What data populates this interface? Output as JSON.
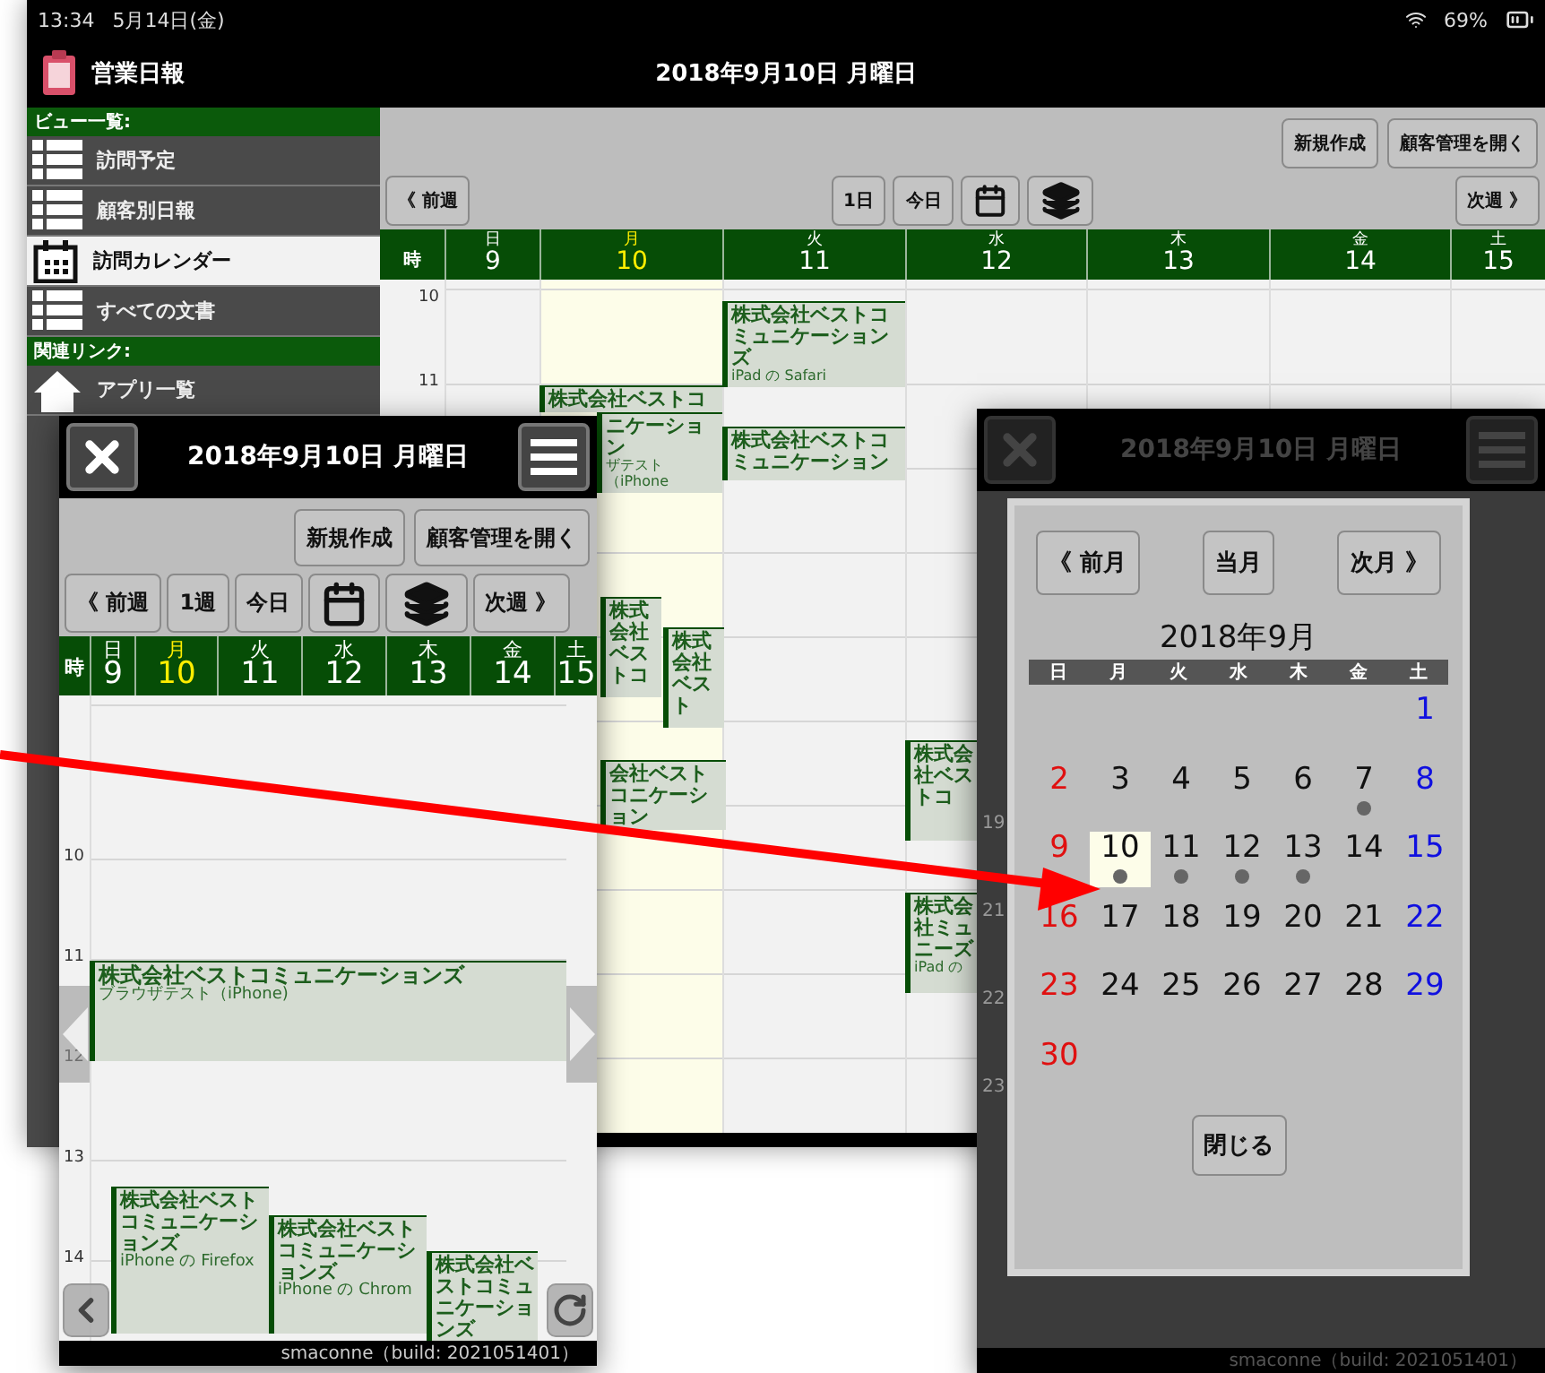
{
  "status_bar": {
    "time": "13:34",
    "date": "5月14日(金)",
    "battery": "69%"
  },
  "app": {
    "title": "営業日報",
    "date_title": "2018年9月10日 月曜日"
  },
  "sidebar": {
    "sections": [
      {
        "title": "ビュー一覧:",
        "items": [
          {
            "label": "訪問予定",
            "kind": "list",
            "selected": false
          },
          {
            "label": "顧客別日報",
            "kind": "list",
            "selected": false
          },
          {
            "label": "訪問カレンダー",
            "kind": "calendar",
            "selected": true
          },
          {
            "label": "すべての文書",
            "kind": "list",
            "selected": false
          }
        ]
      },
      {
        "title": "関連リンク:",
        "items": [
          {
            "label": "アプリ一覧",
            "kind": "home",
            "selected": false
          }
        ]
      }
    ]
  },
  "toolbar": {
    "actions": [
      "新規作成",
      "顧客管理を開く"
    ],
    "prev": "《 前週",
    "view": "1日",
    "today": "今日",
    "next": "次週 》"
  },
  "week": {
    "time_header": "時",
    "days": [
      {
        "weekday": "日",
        "day": "9",
        "selected": false
      },
      {
        "weekday": "月",
        "day": "10",
        "selected": true
      },
      {
        "weekday": "火",
        "day": "11",
        "selected": false
      },
      {
        "weekday": "水",
        "day": "12",
        "selected": false
      },
      {
        "weekday": "木",
        "day": "13",
        "selected": false
      },
      {
        "weekday": "金",
        "day": "14",
        "selected": false
      },
      {
        "weekday": "土",
        "day": "15",
        "selected": false
      }
    ],
    "hours": [
      "10",
      "11"
    ],
    "events": [
      {
        "title": "株式会社ベストコミュニケーションズ",
        "sub": "iPad の Safari"
      },
      {
        "title": "株式会社ベストコ"
      },
      {
        "title": "ニケーション",
        "sub": "ザテスト（iPhone"
      },
      {
        "title": "株式会社ベストコミュニケーション"
      },
      {
        "title": "株式会社ベストコ"
      },
      {
        "title": "株式会社ベスト"
      },
      {
        "title": "会社ベストコニケーション"
      },
      {
        "title": "株式会社ベストコ"
      },
      {
        "title": "株式会社ミュニーズ",
        "sub": "iPad の"
      }
    ]
  },
  "phone": {
    "title": "2018年9月10日 月曜日",
    "actions": [
      "新規作成",
      "顧客管理を開く"
    ],
    "prev": "《 前週",
    "view": "1週",
    "today": "今日",
    "next": "次週 》",
    "time_header": "時",
    "days": [
      {
        "weekday": "日",
        "day": "9",
        "selected": false
      },
      {
        "weekday": "月",
        "day": "10",
        "selected": true
      },
      {
        "weekday": "火",
        "day": "11",
        "selected": false
      },
      {
        "weekday": "水",
        "day": "12",
        "selected": false
      },
      {
        "weekday": "木",
        "day": "13",
        "selected": false
      },
      {
        "weekday": "金",
        "day": "14",
        "selected": false
      },
      {
        "weekday": "土",
        "day": "15",
        "selected": false
      }
    ],
    "hours": [
      "10",
      "11",
      "12",
      "13",
      "14"
    ],
    "events": [
      {
        "title": "株式会社ベストコミュニケーションズ",
        "sub": "ブラウザテスト（iPhone)"
      },
      {
        "title": "株式会社ベストコミュニケーションズ",
        "sub": "iPhone の Firefox"
      },
      {
        "title": "株式会社ベストコミュニケーションズ",
        "sub": "iPhone の Chrom"
      },
      {
        "title": "株式会社ベストコミュニケーションズ"
      }
    ],
    "footer": "smaconne（build: 2021051401）"
  },
  "picker": {
    "title": "2018年9月10日 月曜日",
    "hours": [
      "19",
      "21",
      "22",
      "23"
    ],
    "prev": "《 前月",
    "current": "当月",
    "next": "次月 》",
    "month": "2018年9月",
    "weekdays": [
      "日",
      "月",
      "火",
      "水",
      "木",
      "金",
      "土"
    ],
    "weeks": [
      [
        {
          "day": "1",
          "selected": false,
          "has_events": false
        }
      ],
      [
        {
          "day": "2",
          "selected": false,
          "has_events": false
        },
        {
          "day": "3",
          "selected": false,
          "has_events": false
        },
        {
          "day": "4",
          "selected": false,
          "has_events": false
        },
        {
          "day": "5",
          "selected": false,
          "has_events": false
        },
        {
          "day": "6",
          "selected": false,
          "has_events": false
        },
        {
          "day": "7",
          "selected": false,
          "has_events": true
        },
        {
          "day": "8",
          "selected": false,
          "has_events": false
        }
      ],
      [
        {
          "day": "9",
          "selected": false,
          "has_events": false
        },
        {
          "day": "10",
          "selected": true,
          "has_events": true
        },
        {
          "day": "11",
          "selected": false,
          "has_events": true
        },
        {
          "day": "12",
          "selected": false,
          "has_events": true
        },
        {
          "day": "13",
          "selected": false,
          "has_events": true
        },
        {
          "day": "14",
          "selected": false,
          "has_events": false
        },
        {
          "day": "15",
          "selected": false,
          "has_events": false
        }
      ],
      [
        {
          "day": "16",
          "selected": false,
          "has_events": false
        },
        {
          "day": "17",
          "selected": false,
          "has_events": false
        },
        {
          "day": "18",
          "selected": false,
          "has_events": false
        },
        {
          "day": "19",
          "selected": false,
          "has_events": false
        },
        {
          "day": "20",
          "selected": false,
          "has_events": false
        },
        {
          "day": "21",
          "selected": false,
          "has_events": false
        },
        {
          "day": "22",
          "selected": false,
          "has_events": false
        }
      ],
      [
        {
          "day": "23",
          "selected": false,
          "has_events": false
        },
        {
          "day": "24",
          "selected": false,
          "has_events": false
        },
        {
          "day": "25",
          "selected": false,
          "has_events": false
        },
        {
          "day": "26",
          "selected": false,
          "has_events": false
        },
        {
          "day": "27",
          "selected": false,
          "has_events": false
        },
        {
          "day": "28",
          "selected": false,
          "has_events": false
        },
        {
          "day": "29",
          "selected": false,
          "has_events": false
        }
      ],
      [
        {
          "day": "30",
          "selected": false,
          "has_events": false
        }
      ]
    ],
    "close": "閉じる",
    "footer": "smaconne（build: 2021051401）"
  }
}
